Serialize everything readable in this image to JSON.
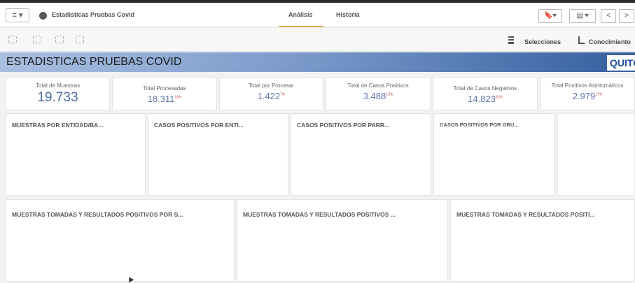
{
  "nav": {
    "menu_label": "≡ ▾",
    "app_title": "Estadisticas Pruebas Covid",
    "tabs": [
      {
        "label": "Análisis"
      },
      {
        "label": "Historia"
      }
    ],
    "bookmark_label": "🔖▾",
    "sheet_btn_label": "▤ ▾",
    "prev_label": "<",
    "next_label": ">"
  },
  "toolbar": {
    "selecciones_label": "Selecciones",
    "conocimiento_label": "Conocimiento"
  },
  "sheet": {
    "title": "ESTADISTICAS PRUEBAS COVID",
    "logo_text": "QUITO"
  },
  "kpis": [
    {
      "label": "Total de Muestras",
      "value": "19.733",
      "sup": ""
    },
    {
      "label": "Total Procesadas",
      "value": "18.311",
      "sup": "93%"
    },
    {
      "label": "Total por Procesar",
      "value": "1.422",
      "sup": "7%"
    },
    {
      "label": "Total de Casos Positivos",
      "value": "3.488",
      "sup": "19%"
    },
    {
      "label": "Total de Casos Negativos",
      "value": "14.823",
      "sup": "81%"
    },
    {
      "label": "Total Positivos Asintomáticos",
      "value": "2.979",
      "sup": "17%"
    }
  ],
  "panels_row1": [
    {
      "title": "MUESTRAS POR ENTIDAD/BA..."
    },
    {
      "title": "CASOS POSITIVOS POR ENTI..."
    },
    {
      "title": "CASOS POSITIVOS POR PARR..."
    },
    {
      "title": "CASOS POSITIVOS POR GRU..."
    }
  ],
  "panels_row2": [
    {
      "title": "MUESTRAS TOMADAS Y RESULTADOS POSITIVOS POR S..."
    },
    {
      "title": "MUESTRAS TOMADAS Y RESULTADOS POSITIVOS ..."
    },
    {
      "title": "MUESTRAS TOMADAS Y RESULTADOS POSITI..."
    }
  ],
  "colors": {
    "accent_tab": "#e0a84e",
    "kpi_value": "#5f77a8",
    "kpi_percent": "#c0504d",
    "header_gradient_end": "#355f9f"
  }
}
